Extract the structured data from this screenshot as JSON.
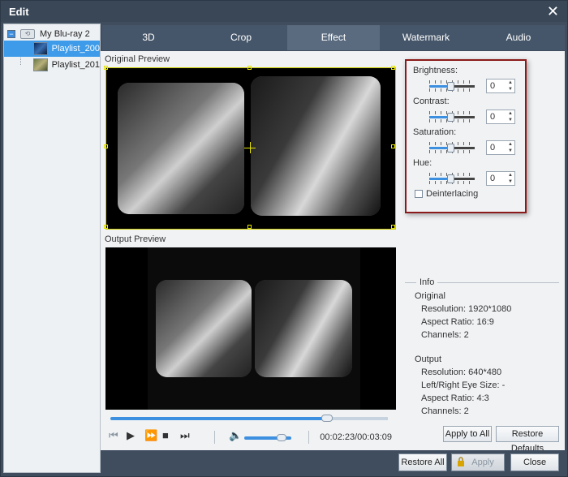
{
  "window": {
    "title": "Edit",
    "close_icon": "close-icon"
  },
  "sidebar": {
    "root_label": "My Blu-ray 2",
    "items": [
      {
        "label": "Playlist_200",
        "selected": true
      },
      {
        "label": "Playlist_201",
        "selected": false
      }
    ]
  },
  "tabs": [
    {
      "label": "3D",
      "active": false
    },
    {
      "label": "Crop",
      "active": false
    },
    {
      "label": "Effect",
      "active": true
    },
    {
      "label": "Watermark",
      "active": false
    },
    {
      "label": "Audio",
      "active": false
    }
  ],
  "preview": {
    "original_label": "Original Preview",
    "output_label": "Output Preview"
  },
  "player": {
    "progress_fraction": 0.78,
    "volume_fraction": 0.8,
    "timecode": "00:02:23/00:03:09"
  },
  "effect": {
    "brightness_label": "Brightness:",
    "brightness_value": "0",
    "contrast_label": "Contrast:",
    "contrast_value": "0",
    "saturation_label": "Saturation:",
    "saturation_value": "0",
    "hue_label": "Hue:",
    "hue_value": "0",
    "deinterlace_label": "Deinterlacing",
    "deinterlace_checked": false
  },
  "info": {
    "heading": "Info",
    "original_heading": "Original",
    "original_resolution": "Resolution: 1920*1080",
    "original_aspect": "Aspect Ratio: 16:9",
    "original_channels": "Channels: 2",
    "output_heading": "Output",
    "output_resolution": "Resolution: 640*480",
    "output_eye_size": "Left/Right Eye Size: -",
    "output_aspect": "Aspect Ratio: 4:3",
    "output_channels": "Channels: 2"
  },
  "buttons": {
    "apply_to_all": "Apply to All",
    "restore_defaults": "Restore Defaults",
    "restore_all": "Restore All",
    "apply": "Apply",
    "close": "Close"
  },
  "colors": {
    "accent": "#3d9be9",
    "highlight_border": "#8b1a1a",
    "crop_border": "#c9c900"
  }
}
